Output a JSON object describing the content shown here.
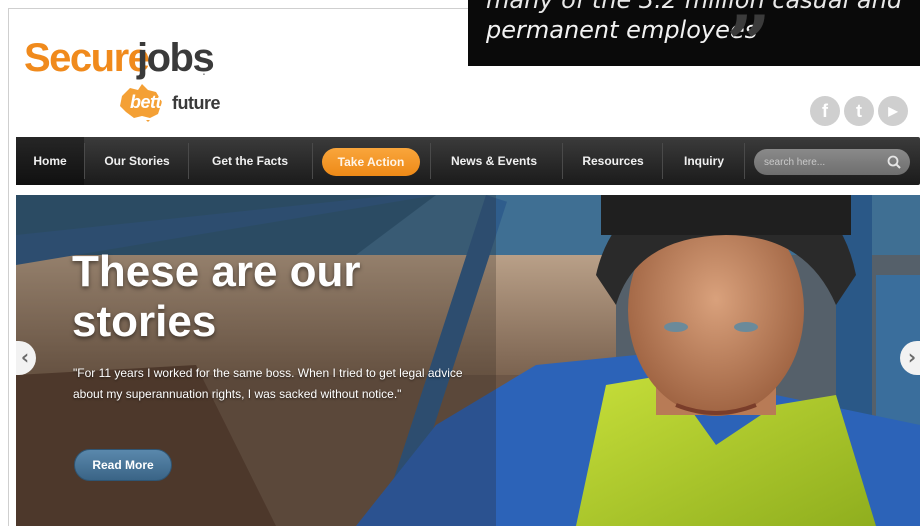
{
  "logo": {
    "secure": "Secure",
    "jobs": "jobs",
    "dot": ".",
    "better": "better",
    "future": "future"
  },
  "quote_box": {
    "line_partial": "many of the 3.2 million casual and",
    "line": "permanent employees",
    "mark": "”"
  },
  "social": [
    {
      "name": "facebook",
      "glyph": "f"
    },
    {
      "name": "twitter",
      "glyph": "t"
    },
    {
      "name": "youtube",
      "glyph": "▶"
    }
  ],
  "nav": {
    "items": [
      "Home",
      "Our Stories",
      "Get the Facts",
      "Take Action",
      "News & Events",
      "Resources",
      "Inquiry"
    ],
    "search_placeholder": "search here..."
  },
  "hero": {
    "title": "These are our stories",
    "quote": "\"For 11 years I worked for the same boss. When I tried to get legal advice about my superannuation rights, I was sacked without notice.\"",
    "button": "Read More",
    "prev": "‹",
    "next": "›"
  },
  "colors": {
    "brand_orange": "#f08a1c",
    "nav_dark": "#1b1b1b",
    "button_blue": "#3a6486"
  }
}
